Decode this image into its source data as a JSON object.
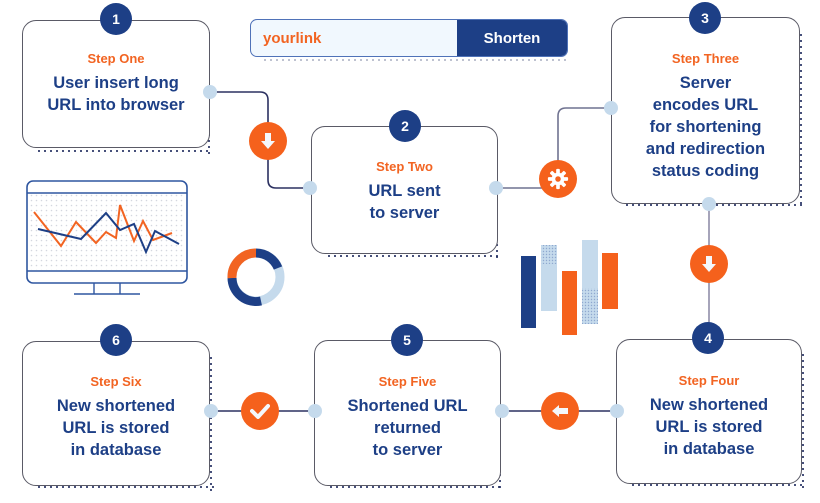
{
  "search": {
    "value": "yourlink",
    "button_label": "Shorten"
  },
  "steps": [
    {
      "number": "1",
      "label": "Step One",
      "lines": [
        "User insert long",
        "URL into browser"
      ]
    },
    {
      "number": "2",
      "label": "Step Two",
      "lines": [
        "URL sent",
        "to server"
      ]
    },
    {
      "number": "3",
      "label": "Step Three",
      "lines": [
        "Server",
        "encodes URL",
        "for shortening",
        "and redirection",
        "status coding"
      ]
    },
    {
      "number": "4",
      "label": "Step Four",
      "lines": [
        "New shortened",
        "URL is stored",
        "in database"
      ]
    },
    {
      "number": "5",
      "label": "Step Five",
      "lines": [
        "Shortened URL",
        "returned",
        "to server"
      ]
    },
    {
      "number": "6",
      "label": "Step Six",
      "lines": [
        "New shortened",
        "URL is stored",
        "in database"
      ]
    }
  ],
  "connector_icons": [
    "arrow-down-icon",
    "gear-icon",
    "arrow-down-icon",
    "arrow-left-icon",
    "checkmark-icon"
  ],
  "colors": {
    "primary_blue": "#1d3f86",
    "accent_orange": "#f5611c",
    "light_blue": "#c5daec"
  },
  "decorations": {
    "monitor_chart": "line-chart-monitor",
    "donut": "donut-chart",
    "bars": "bar-chart"
  }
}
